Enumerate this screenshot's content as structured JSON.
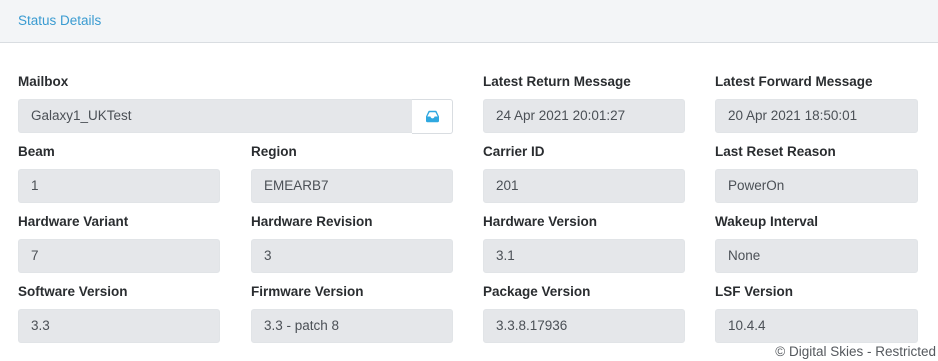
{
  "header": {
    "title": "Status Details"
  },
  "fields": {
    "mailbox": {
      "label": "Mailbox",
      "value": "Galaxy1_UKTest"
    },
    "latest_return": {
      "label": "Latest Return Message",
      "value": "24 Apr 2021 20:01:27"
    },
    "latest_forward": {
      "label": "Latest Forward Message",
      "value": "20 Apr 2021 18:50:01"
    },
    "beam": {
      "label": "Beam",
      "value": "1"
    },
    "region": {
      "label": "Region",
      "value": "EMEARB7"
    },
    "carrier_id": {
      "label": "Carrier ID",
      "value": "201"
    },
    "last_reset": {
      "label": "Last Reset Reason",
      "value": "PowerOn"
    },
    "hw_variant": {
      "label": "Hardware Variant",
      "value": "7"
    },
    "hw_revision": {
      "label": "Hardware Revision",
      "value": "3"
    },
    "hw_version": {
      "label": "Hardware Version",
      "value": "3.1"
    },
    "wakeup": {
      "label": "Wakeup Interval",
      "value": "None"
    },
    "sw_version": {
      "label": "Software Version",
      "value": "3.3"
    },
    "fw_version": {
      "label": "Firmware Version",
      "value": "3.3 - patch 8"
    },
    "pkg_version": {
      "label": "Package Version",
      "value": "3.3.8.17936"
    },
    "lsf_version": {
      "label": "LSF Version",
      "value": "10.4.4"
    }
  },
  "mailbox_action": {
    "icon": "inbox-icon",
    "color": "#2fa8e0"
  },
  "footer": {
    "text": "© Digital Skies - Restricted"
  }
}
